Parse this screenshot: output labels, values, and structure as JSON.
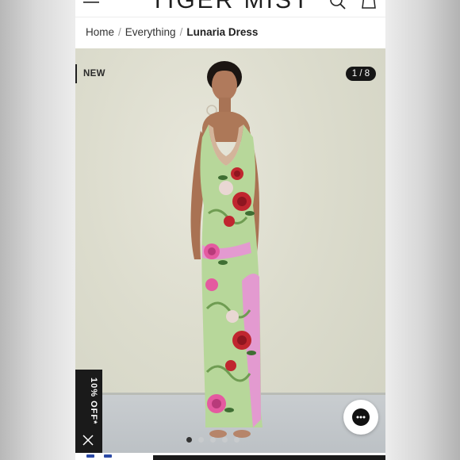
{
  "header": {
    "logo_text": "TIGER MIST",
    "menu_icon": "hamburger-menu-icon",
    "search_icon": "search-icon",
    "bag_icon": "shopping-bag-icon"
  },
  "breadcrumb": {
    "items": [
      "Home",
      "Everything"
    ],
    "separator": "/",
    "current": "Lunaria Dress"
  },
  "gallery": {
    "badge": "NEW",
    "counter": "1 / 8",
    "total_images": 8,
    "active_index": 1
  },
  "promo": {
    "discount_label": "10% OFF*",
    "close_icon": "close-icon"
  },
  "chat": {
    "icon": "chat-bubble-icon"
  },
  "colors": {
    "accent": "#1a1a1a",
    "dress_green": "#b7d79a",
    "dress_pink": "#e39ad0",
    "rose_red": "#c0262f"
  }
}
